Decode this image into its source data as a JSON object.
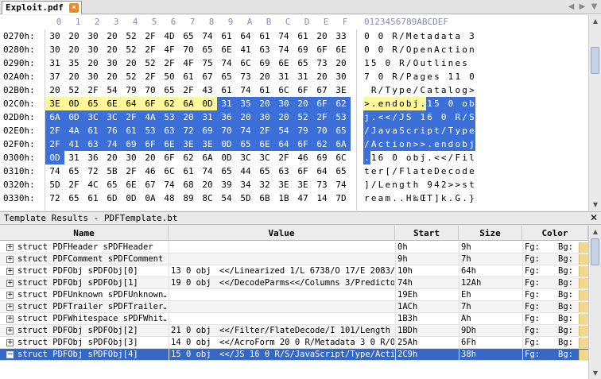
{
  "tab": {
    "title": "Exploit.pdf",
    "close_glyph": "×",
    "prev_glyph": "◀",
    "next_glyph": "▶",
    "menu_glyph": "▼"
  },
  "hex": {
    "column_headers": [
      "0",
      "1",
      "2",
      "3",
      "4",
      "5",
      "6",
      "7",
      "8",
      "9",
      "A",
      "B",
      "C",
      "D",
      "E",
      "F"
    ],
    "ascii_header": "0123456789ABCDEF",
    "rows": [
      {
        "addr": "0270h:",
        "bytes": [
          "30",
          "20",
          "30",
          "20",
          "52",
          "2F",
          "4D",
          "65",
          "74",
          "61",
          "64",
          "61",
          "74",
          "61",
          "20",
          "33"
        ],
        "ascii": "0 0 R/Metadata 3",
        "hl": "nnnnnnnnnnnnnnnn"
      },
      {
        "addr": "0280h:",
        "bytes": [
          "30",
          "20",
          "30",
          "20",
          "52",
          "2F",
          "4F",
          "70",
          "65",
          "6E",
          "41",
          "63",
          "74",
          "69",
          "6F",
          "6E"
        ],
        "ascii": "0 0 R/OpenAction",
        "hl": "nnnnnnnnnnnnnnnn"
      },
      {
        "addr": "0290h:",
        "bytes": [
          "31",
          "35",
          "20",
          "30",
          "20",
          "52",
          "2F",
          "4F",
          "75",
          "74",
          "6C",
          "69",
          "6E",
          "65",
          "73",
          "20"
        ],
        "ascii": "15 0 R/Outlines ",
        "hl": "nnnnnnnnnnnnnnnn"
      },
      {
        "addr": "02A0h:",
        "bytes": [
          "37",
          "20",
          "30",
          "20",
          "52",
          "2F",
          "50",
          "61",
          "67",
          "65",
          "73",
          "20",
          "31",
          "31",
          "20",
          "30"
        ],
        "ascii": "7 0 R/Pages 11 0",
        "hl": "nnnnnnnnnnnnnnnn"
      },
      {
        "addr": "02B0h:",
        "bytes": [
          "20",
          "52",
          "2F",
          "54",
          "79",
          "70",
          "65",
          "2F",
          "43",
          "61",
          "74",
          "61",
          "6C",
          "6F",
          "67",
          "3E"
        ],
        "ascii": " R/Type/Catalog>",
        "hl": "nnnnnnnnnnnnnnnn"
      },
      {
        "addr": "02C0h:",
        "bytes": [
          "3E",
          "0D",
          "65",
          "6E",
          "64",
          "6F",
          "62",
          "6A",
          "0D",
          "31",
          "35",
          "20",
          "30",
          "20",
          "6F",
          "62"
        ],
        "ascii": ">.endobj.15 0 ob",
        "hl": "yyyyyyyyybbbbbbb"
      },
      {
        "addr": "02D0h:",
        "bytes": [
          "6A",
          "0D",
          "3C",
          "3C",
          "2F",
          "4A",
          "53",
          "20",
          "31",
          "36",
          "20",
          "30",
          "20",
          "52",
          "2F",
          "53"
        ],
        "ascii": "j.<</JS 16 0 R/S",
        "hl": "bbbbbbbbbbbbbbbb"
      },
      {
        "addr": "02E0h:",
        "bytes": [
          "2F",
          "4A",
          "61",
          "76",
          "61",
          "53",
          "63",
          "72",
          "69",
          "70",
          "74",
          "2F",
          "54",
          "79",
          "70",
          "65"
        ],
        "ascii": "/JavaScript/Type",
        "hl": "bbbbbbbbbbbbbbbb"
      },
      {
        "addr": "02F0h:",
        "bytes": [
          "2F",
          "41",
          "63",
          "74",
          "69",
          "6F",
          "6E",
          "3E",
          "3E",
          "0D",
          "65",
          "6E",
          "64",
          "6F",
          "62",
          "6A"
        ],
        "ascii": "/Action>>.endobj",
        "hl": "bbbbbbbbbbbbbbbb"
      },
      {
        "addr": "0300h:",
        "bytes": [
          "0D",
          "31",
          "36",
          "20",
          "30",
          "20",
          "6F",
          "62",
          "6A",
          "0D",
          "3C",
          "3C",
          "2F",
          "46",
          "69",
          "6C"
        ],
        "ascii": ".16 0 obj.<</Fil",
        "hl": "bnnnnnnnnnnnnnnn"
      },
      {
        "addr": "0310h:",
        "bytes": [
          "74",
          "65",
          "72",
          "5B",
          "2F",
          "46",
          "6C",
          "61",
          "74",
          "65",
          "44",
          "65",
          "63",
          "6F",
          "64",
          "65"
        ],
        "ascii": "ter[/FlateDecode",
        "hl": "nnnnnnnnnnnnnnnn"
      },
      {
        "addr": "0320h:",
        "bytes": [
          "5D",
          "2F",
          "4C",
          "65",
          "6E",
          "67",
          "74",
          "68",
          "20",
          "39",
          "34",
          "32",
          "3E",
          "3E",
          "73",
          "74"
        ],
        "ascii": "]/Length 942>>st",
        "hl": "nnnnnnnnnnnnnnnn"
      },
      {
        "addr": "0330h:",
        "bytes": [
          "72",
          "65",
          "61",
          "6D",
          "0D",
          "0A",
          "48",
          "89",
          "8C",
          "54",
          "5D",
          "6B",
          "1B",
          "47",
          "14",
          "7D"
        ],
        "ascii": "ream..H‰ŒT]k.G.}",
        "hl": "nnnnnnnnnnnnnnnn"
      }
    ]
  },
  "template": {
    "title": "Template Results - PDFTemplate.bt",
    "close_glyph": "✕",
    "columns": [
      "Name",
      "Value",
      "Start",
      "Size",
      "Color"
    ],
    "rows": [
      {
        "expander": "+",
        "name": "struct PDFHeader sPDFHeader",
        "value_a": "",
        "value_b": "",
        "start": "0h",
        "size": "9h",
        "fg": "Fg:",
        "bg": "Bg:"
      },
      {
        "expander": "+",
        "name": "struct PDFComment sPDFComment",
        "value_a": "",
        "value_b": "",
        "start": "9h",
        "size": "7h",
        "fg": "Fg:",
        "bg": "Bg:"
      },
      {
        "expander": "+",
        "name": "struct PDFObj sPDFObj[0]",
        "value_a": "13 0 obj",
        "value_b": "<</Linearized 1/L 6738/O 17/E 2083/…",
        "start": "10h",
        "size": "64h",
        "fg": "Fg:",
        "bg": "Bg:"
      },
      {
        "expander": "+",
        "name": "struct PDFObj sPDFObj[1]",
        "value_a": "19 0 obj",
        "value_b": "<</DecodeParms<</Columns 3/Predicto…",
        "start": "74h",
        "size": "12Ah",
        "fg": "Fg:",
        "bg": "Bg:"
      },
      {
        "expander": "+",
        "name": "struct PDFUnknown sPDFUnknown…",
        "value_a": "",
        "value_b": "",
        "start": "19Eh",
        "size": "Eh",
        "fg": "Fg:",
        "bg": "Bg:"
      },
      {
        "expander": "+",
        "name": "struct PDFTrailer sPDFTrailer…",
        "value_a": "",
        "value_b": "",
        "start": "1ACh",
        "size": "7h",
        "fg": "Fg:",
        "bg": "Bg:"
      },
      {
        "expander": "+",
        "name": "struct PDFWhitespace sPDFWhit…",
        "value_a": "",
        "value_b": "",
        "start": "1B3h",
        "size": "Ah",
        "fg": "Fg:",
        "bg": "Bg:"
      },
      {
        "expander": "+",
        "name": "struct PDFObj sPDFObj[2]",
        "value_a": "21 0 obj",
        "value_b": "<</Filter/FlateDecode/I 101/Length …",
        "start": "1BDh",
        "size": "9Dh",
        "fg": "Fg:",
        "bg": "Bg:"
      },
      {
        "expander": "+",
        "name": "struct PDFObj sPDFObj[3]",
        "value_a": "14 0 obj",
        "value_b": "<</AcroForm 20 0 R/Metadata 3 0 R/O…",
        "start": "25Ah",
        "size": "6Fh",
        "fg": "Fg:",
        "bg": "Bg:"
      },
      {
        "expander": "−",
        "name": "struct PDFObj sPDFObj[4]",
        "value_a": "15 0 obj",
        "value_b": "<</JS 16 0 R/S/JavaScript/Type/Acti…",
        "start": "2C9h",
        "size": "38h",
        "fg": "Fg:",
        "bg": "Bg:",
        "selected": true
      }
    ]
  },
  "colors": {
    "selection_blue": "#3c6fd8",
    "highlight_yellow": "#fff799",
    "row_selected": "#3468c4",
    "tab_close": "#e88a2a"
  }
}
